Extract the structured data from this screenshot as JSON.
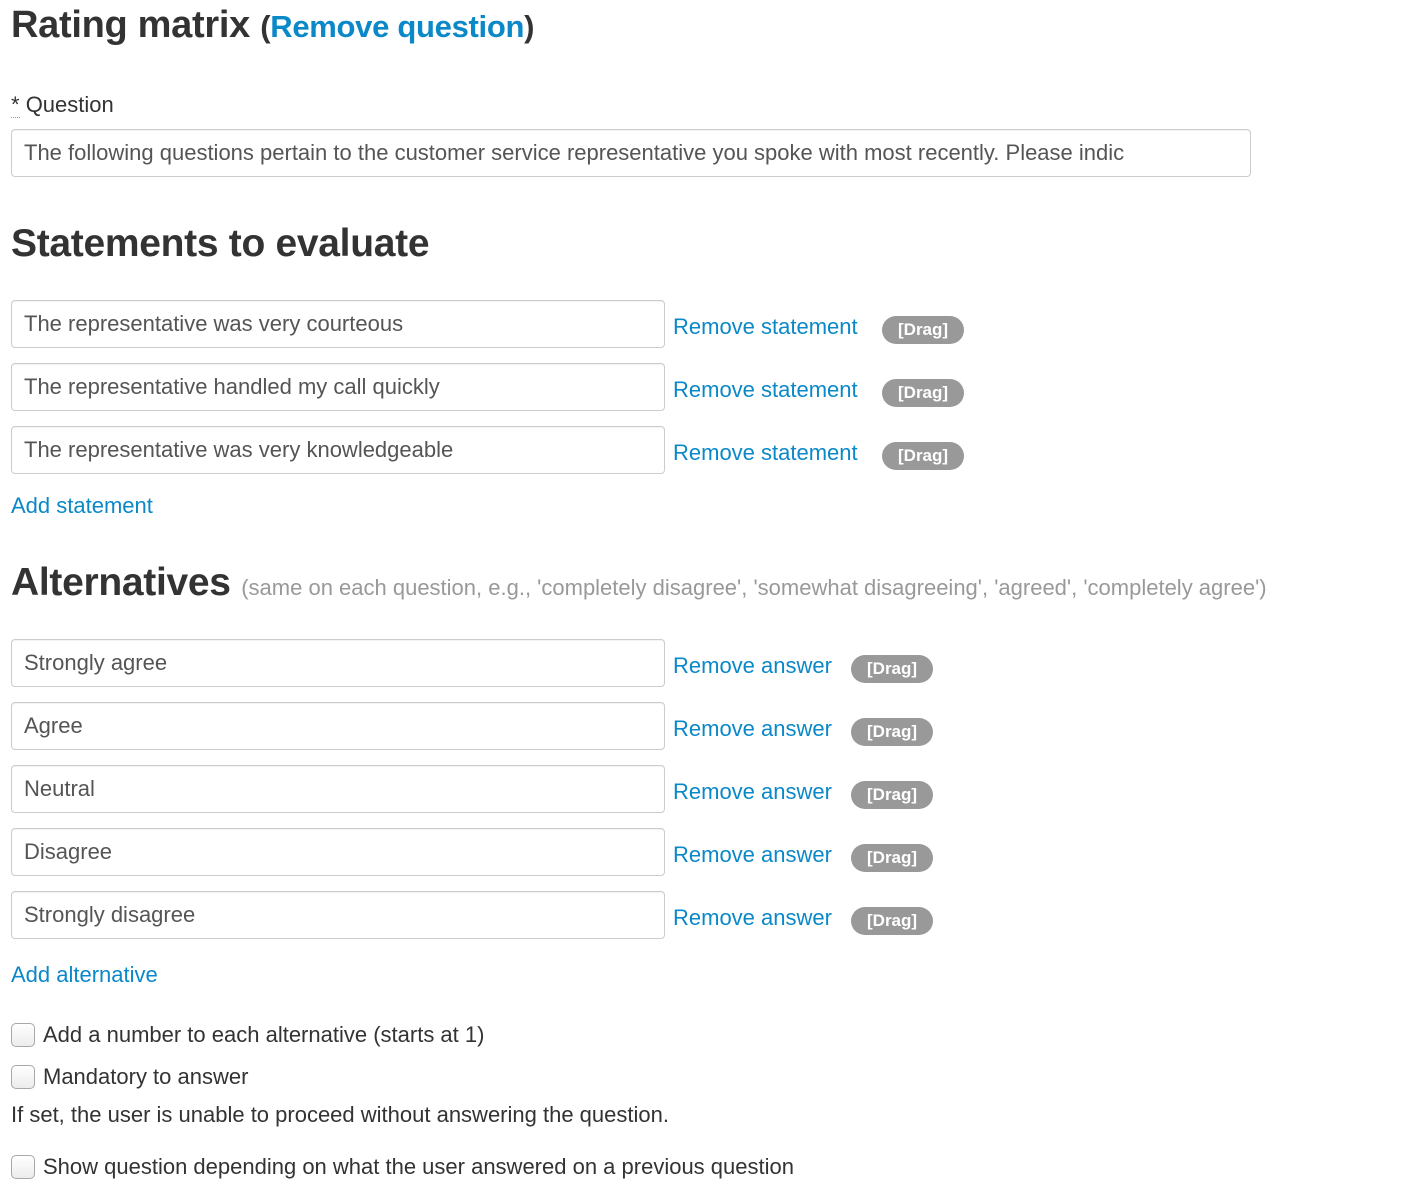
{
  "header": {
    "title": "Rating matrix",
    "open_paren": "(",
    "remove_question_label": "Remove question",
    "close_paren": ")"
  },
  "question": {
    "required_marker": "*",
    "label": "Question",
    "value": "The following questions pertain to the customer service representative you spoke with most recently. Please indic"
  },
  "statements": {
    "heading": "Statements to evaluate",
    "items": [
      {
        "value": "The representative was very courteous",
        "remove_label": "Remove statement",
        "drag_label": "[Drag]"
      },
      {
        "value": "The representative handled my call quickly",
        "remove_label": "Remove statement",
        "drag_label": "[Drag]"
      },
      {
        "value": "The representative was very knowledgeable",
        "remove_label": "Remove statement",
        "drag_label": "[Drag]"
      }
    ],
    "add_label": "Add statement"
  },
  "alternatives": {
    "heading": "Alternatives",
    "hint": "(same on each question, e.g., 'completely disagree', 'somewhat disagreeing', 'agreed', 'completely agree')",
    "items": [
      {
        "value": "Strongly agree",
        "remove_label": "Remove answer",
        "drag_label": "[Drag]"
      },
      {
        "value": "Agree",
        "remove_label": "Remove answer",
        "drag_label": "[Drag]"
      },
      {
        "value": "Neutral",
        "remove_label": "Remove answer",
        "drag_label": "[Drag]"
      },
      {
        "value": "Disagree",
        "remove_label": "Remove answer",
        "drag_label": "[Drag]"
      },
      {
        "value": "Strongly disagree",
        "remove_label": "Remove answer",
        "drag_label": "[Drag]"
      }
    ],
    "add_label": "Add alternative"
  },
  "options": {
    "numbering": {
      "label": "Add a number to each alternative (starts at 1)",
      "checked": false
    },
    "mandatory": {
      "label": "Mandatory to answer",
      "checked": false,
      "help": "If set, the user is unable to proceed without answering the question."
    },
    "conditional": {
      "label": "Show question depending on what the user answered on a previous question",
      "checked": false
    }
  },
  "colors": {
    "link": "#0a88c8",
    "heading": "#333333",
    "hint": "#999999",
    "drag_badge_bg": "#999999",
    "input_border": "#cccccc"
  }
}
